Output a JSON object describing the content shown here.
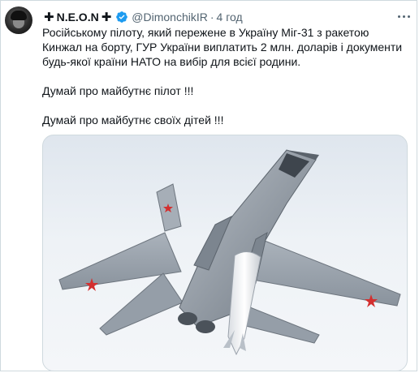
{
  "author": {
    "display_name": "N.E.O.N",
    "handle": "@DimonchikIR",
    "separator": "·",
    "time": "4 год",
    "prefix_symbol": "✚",
    "suffix_symbol": "✚",
    "verified_color": "#1d9bf0"
  },
  "tweet": {
    "paragraph1": "Російському пілоту, який пережене в Україну Міг-31 з ракетою Кинжал на борту, ГУР України виплатить 2 млн. доларів і документи будь-якої країни НАТО на вибір для всієї родини.",
    "paragraph2": "Думай про майбутнє пілот !!!",
    "paragraph3": "Думай про майбутнє своїх дітей !!!"
  },
  "colors": {
    "text": "#0f1419",
    "secondary": "#536471",
    "border": "#cfd9de",
    "star": "#d32f2f"
  },
  "icons": {
    "more": "more-icon",
    "verified": "verified-icon"
  }
}
